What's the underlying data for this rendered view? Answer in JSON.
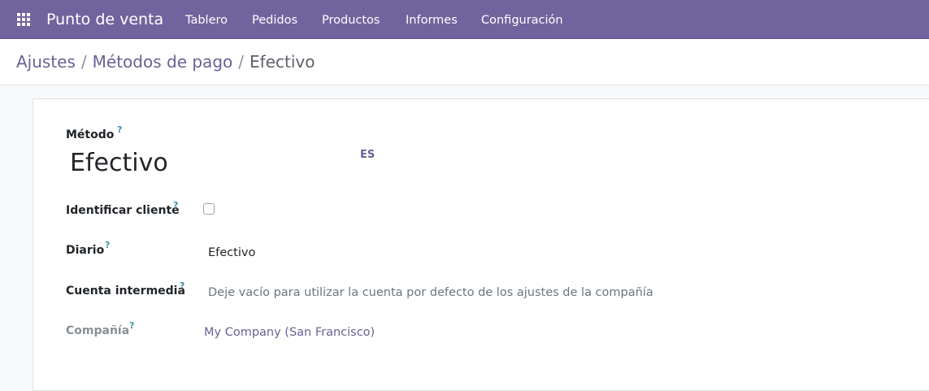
{
  "navbar": {
    "app_name": "Punto de venta",
    "menu": [
      "Tablero",
      "Pedidos",
      "Productos",
      "Informes",
      "Configuración"
    ],
    "apps_icon": "grid-icon"
  },
  "breadcrumb": {
    "items": [
      "Ajustes",
      "Métodos de pago"
    ],
    "separator": "/",
    "current": "Efectivo"
  },
  "form": {
    "method_label": "Método",
    "method_value": "Efectivo",
    "lang_code": "ES",
    "identify_customer_label": "Identificar cliente",
    "identify_customer_checked": false,
    "journal_label": "Diario",
    "journal_value": "Efectivo",
    "intermediary_account_label": "Cuenta intermedia",
    "intermediary_account_placeholder": "Deje vacío para utilizar la cuenta por defecto de los ajustes de la compañía",
    "company_label": "Compañía",
    "company_value": "My Company (San Francisco)",
    "help_mark": "?"
  },
  "colors": {
    "navbar": "#71639e",
    "link": "#6b5f94",
    "help": "#3d8fa6"
  }
}
